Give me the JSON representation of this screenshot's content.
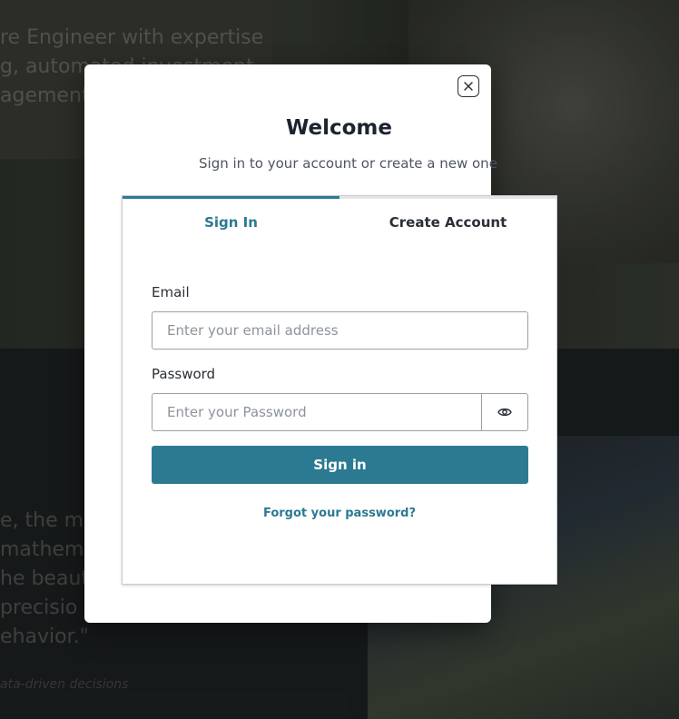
{
  "background": {
    "hero_lines": [
      "re Engineer with expertise",
      "g, automated investment",
      "agement"
    ],
    "quote_lines": [
      "e, the mo",
      " mathem",
      "he beaut",
      "precisio",
      "ehavior.\""
    ],
    "caption": "ata-driven decisions"
  },
  "modal": {
    "title": "Welcome",
    "subtitle": "Sign in to your account or create a new one",
    "close_icon": "close-icon"
  },
  "tabs": [
    {
      "label": "Sign In",
      "active": true
    },
    {
      "label": "Create Account",
      "active": false
    }
  ],
  "form": {
    "email_label": "Email",
    "email_placeholder": "Enter your email address",
    "email_value": "",
    "password_label": "Password",
    "password_placeholder": "Enter your Password",
    "password_value": "",
    "show_password_icon": "eye-icon",
    "submit_label": "Sign in",
    "forgot_label": "Forgot your password?"
  },
  "colors": {
    "accent": "#2c7a92",
    "title": "#1d2430",
    "overlay_background": "#1a1e1f"
  }
}
